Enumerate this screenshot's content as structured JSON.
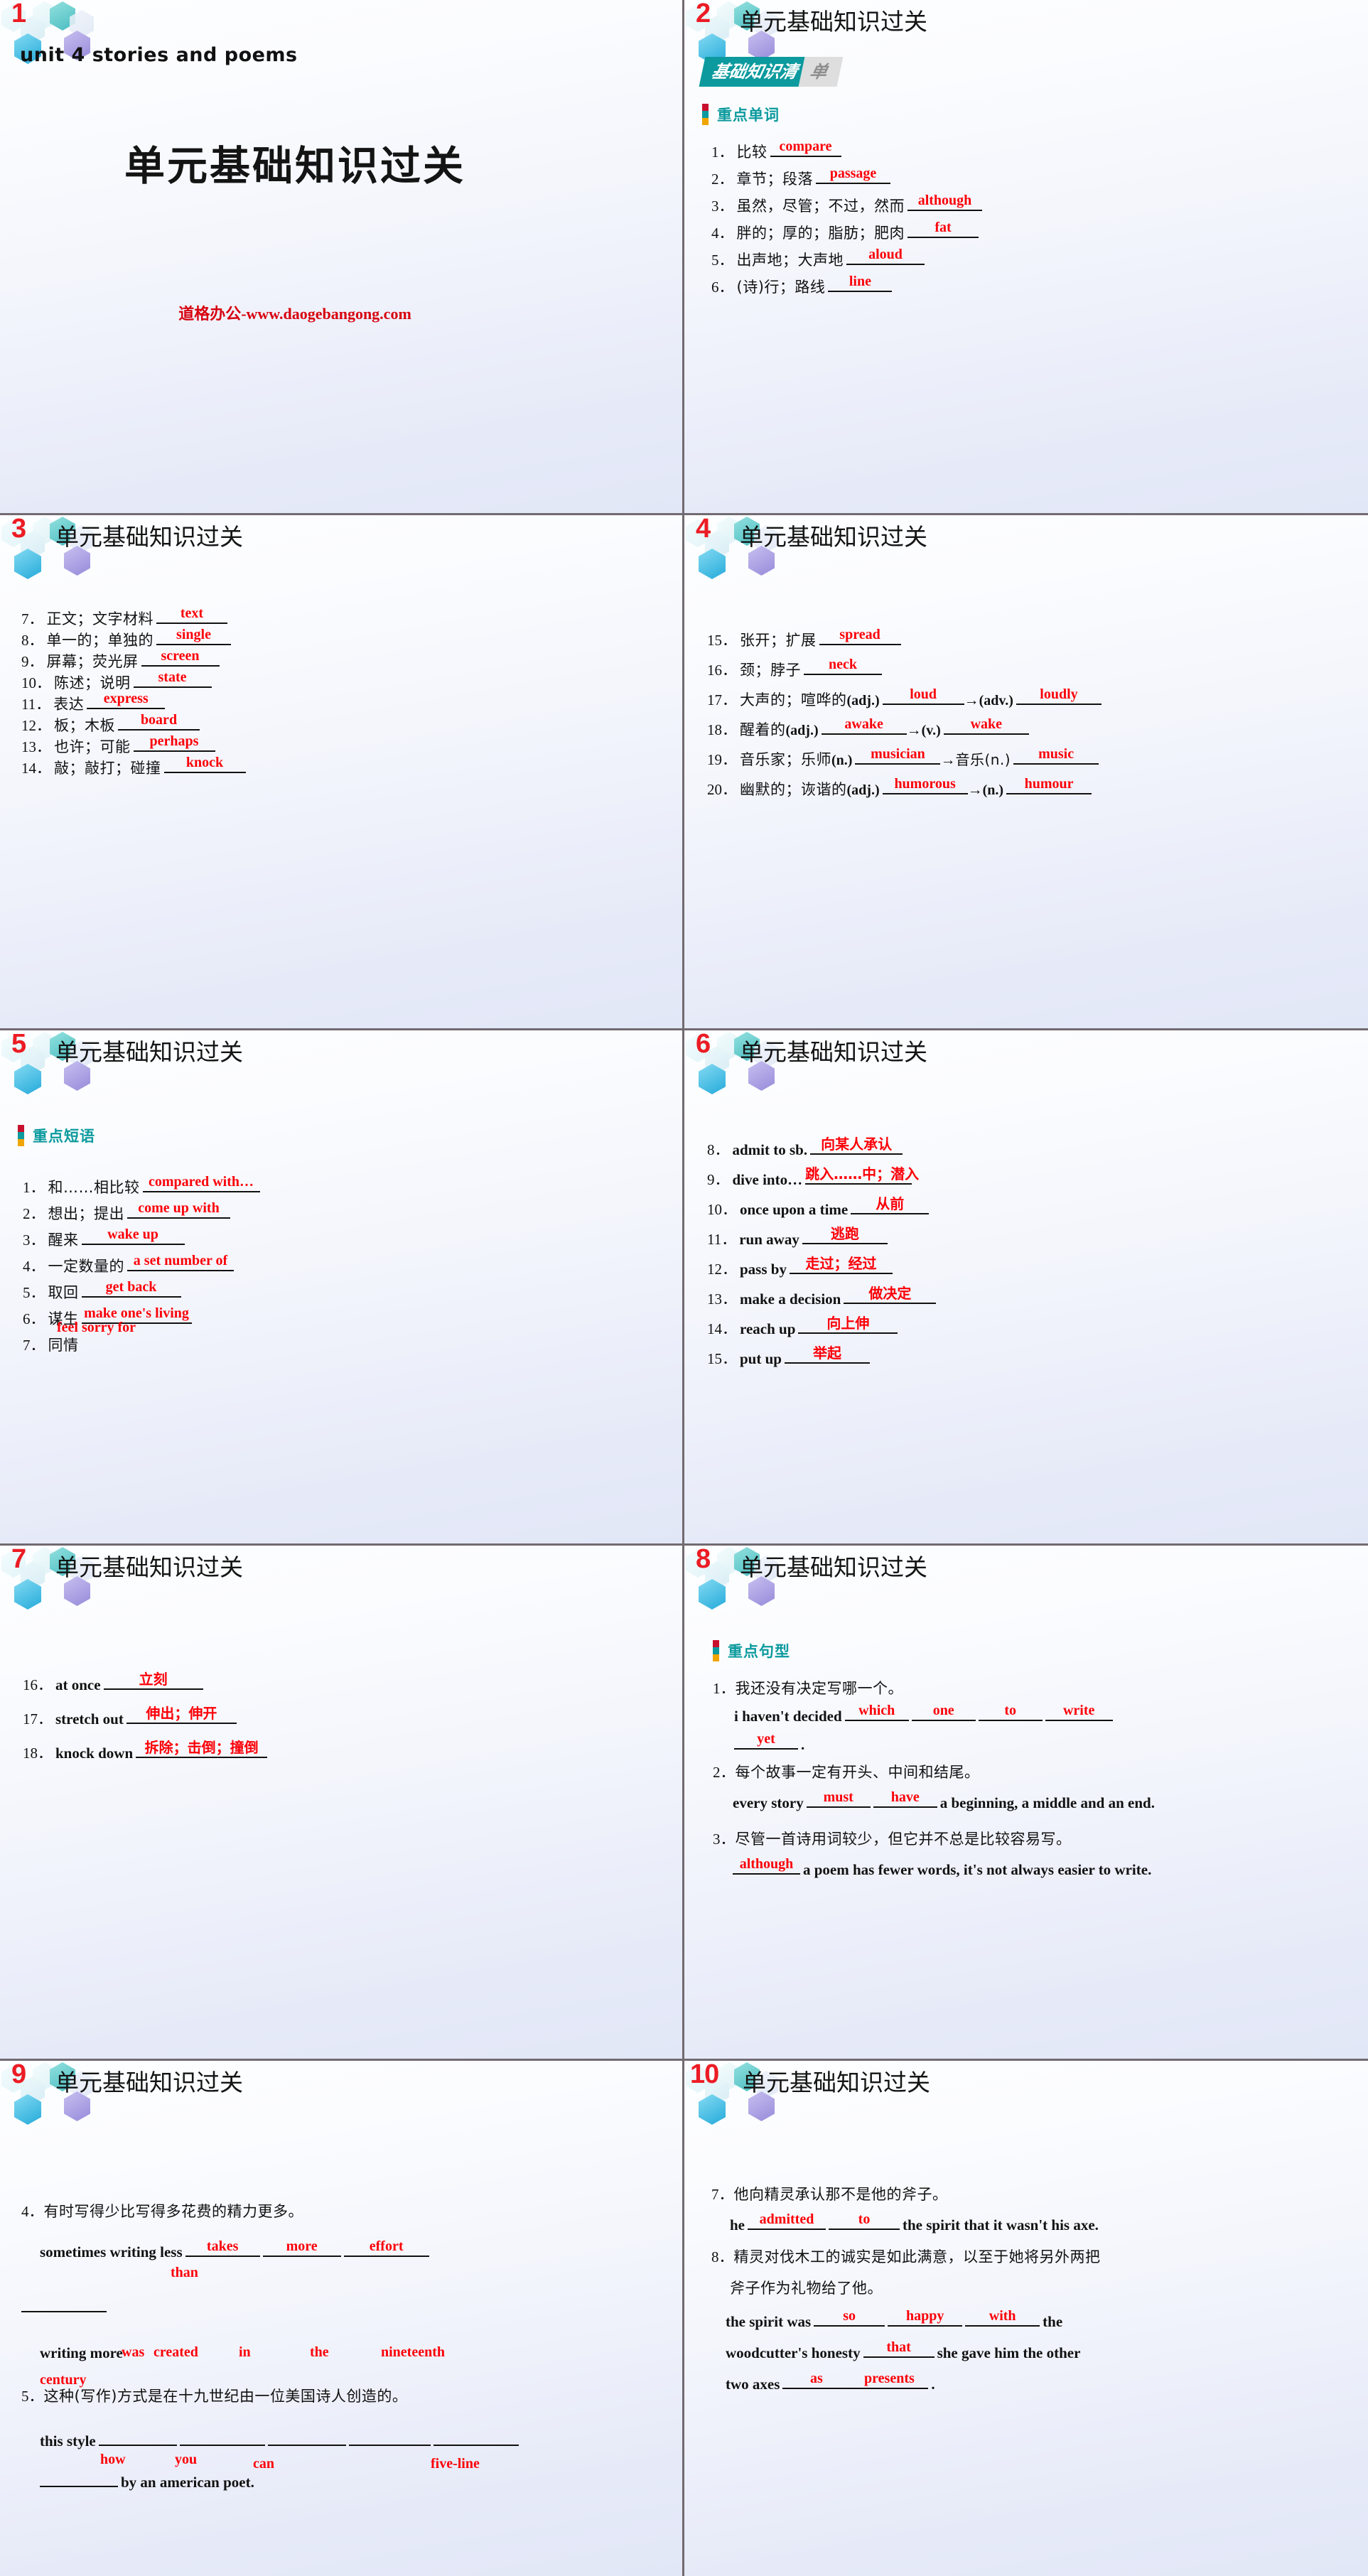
{
  "deck": {
    "header_title": "单元基础知识过关",
    "accent_red": "#fb0007",
    "accent_teal": "#0c9a9e",
    "slide_numbers": [
      "1",
      "2",
      "3",
      "4",
      "5",
      "6",
      "7",
      "8",
      "9",
      "10"
    ]
  },
  "slide1": {
    "unit_line": "unit 4  stories and poems",
    "main_title": "单元基础知识过关",
    "watermark": "道格办公-www.daogebangong.com"
  },
  "slide2": {
    "banner_left": "基础知识清",
    "banner_right": "单",
    "section_label": "重点单词",
    "items": [
      {
        "num": "1．",
        "cn": "比较",
        "answer": "compare",
        "w": 100
      },
      {
        "num": "2．",
        "cn": "章节；段落",
        "answer": "passage",
        "w": 105
      },
      {
        "num": "3．",
        "cn": "虽然，尽管；不过，然而",
        "answer": "although",
        "w": 105
      },
      {
        "num": "4．",
        "cn": "胖的；厚的；脂肪；肥肉",
        "answer": "fat",
        "w": 100
      },
      {
        "num": "5．",
        "cn": "出声地；大声地",
        "answer": "aloud",
        "w": 110
      },
      {
        "num": "6．",
        "cn": "(诗)行；路线",
        "answer": "line",
        "w": 90
      }
    ]
  },
  "slide3": {
    "items": [
      {
        "num": "7．",
        "cn": "正文；文字材料",
        "answer": "text",
        "w": 100
      },
      {
        "num": "8．",
        "cn": "单一的；单独的",
        "answer": "single",
        "w": 105
      },
      {
        "num": "9．",
        "cn": "屏幕；荧光屏",
        "answer": "screen",
        "w": 110
      },
      {
        "num": "10．",
        "cn": "陈述；说明",
        "answer": "state",
        "w": 110
      },
      {
        "num": "11．",
        "cn": "表达",
        "answer": "express",
        "w": 110
      },
      {
        "num": "12．",
        "cn": "板；木板",
        "answer": "board",
        "w": 115
      },
      {
        "num": "13．",
        "cn": "也许；可能",
        "answer": "perhaps",
        "w": 115
      },
      {
        "num": "14．",
        "cn": "敲；敲打；碰撞",
        "answer": "knock",
        "w": 115
      }
    ]
  },
  "slide4": {
    "items": [
      {
        "num": "15．",
        "cn": "张开；扩展",
        "a1": "spread",
        "w1": 115,
        "pos2": "",
        "a2": "",
        "w2": 0,
        "pos1": ""
      },
      {
        "num": "16．",
        "cn": "颈；脖子",
        "a1": "neck",
        "w1": 110,
        "pos2": "",
        "a2": "",
        "w2": 0,
        "pos1": ""
      },
      {
        "num": "17．",
        "cn": "大声的；喧哗的",
        "pos1": "(adj.)",
        "a1": "loud",
        "w1": 115,
        "pos2": "(adv.)",
        "a2": "loudly",
        "w2": 120
      },
      {
        "num": "18．",
        "cn": "醒着的",
        "pos1": "(adj.)",
        "a1": "awake",
        "w1": 120,
        "pos2": "(v.)",
        "a2": "wake",
        "w2": 120
      },
      {
        "num": "19．",
        "cn": "音乐家；乐师",
        "pos1": "(n.)",
        "a1": "musician",
        "w1": 120,
        "pos2": "音乐(n.)",
        "a2": "music",
        "w2": 120
      },
      {
        "num": "20．",
        "cn": "幽默的；诙谐的",
        "pos1": "(adj.)",
        "a1": "humorous",
        "w1": 120,
        "pos2": "(n.)",
        "a2": "humour",
        "w2": 120
      }
    ]
  },
  "slide5": {
    "section_label": "重点短语",
    "items": [
      {
        "num": "1．",
        "cn": "和……相比较",
        "answer": "compared with…",
        "w": 165
      },
      {
        "num": "2．",
        "cn": "想出；提出",
        "answer": "come up with",
        "w": 145
      },
      {
        "num": "3．",
        "cn": "醒来",
        "answer": "wake up",
        "w": 145
      },
      {
        "num": "4．",
        "cn": "一定数量的",
        "answer": "a set number of",
        "w": 150
      },
      {
        "num": "5．",
        "cn": "取回",
        "answer": "get back",
        "w": 140
      },
      {
        "num": "6．",
        "cn": "谋生",
        "answer": "make one's living",
        "w": 155
      },
      {
        "num": "7．",
        "cn": "同情",
        "answer": "feel sorry for",
        "w": 0
      }
    ]
  },
  "slide6": {
    "items": [
      {
        "num": "8．",
        "en": "admit to sb.",
        "answer": "向某人承认",
        "w": 130
      },
      {
        "num": "9．",
        "en": "dive into…",
        "answer": "跳入……中；潜入",
        "w": 150
      },
      {
        "num": "10．",
        "en": "once upon a time",
        "answer": "从前",
        "w": 110
      },
      {
        "num": "11．",
        "en": "run away",
        "answer": "逃跑",
        "w": 120
      },
      {
        "num": "12．",
        "en": "pass by",
        "answer": "走过；经过",
        "w": 145
      },
      {
        "num": "13．",
        "en": "make a decision",
        "answer": "做决定",
        "w": 130
      },
      {
        "num": "14．",
        "en": "reach up",
        "answer": "向上伸",
        "w": 140
      },
      {
        "num": "15．",
        "en": "put up",
        "answer": "举起",
        "w": 120
      }
    ]
  },
  "slide7": {
    "items": [
      {
        "num": "16．",
        "en": "at once",
        "answer": "立刻",
        "w": 140
      },
      {
        "num": "17．",
        "en": "stretch out",
        "answer": "伸出；伸开",
        "w": 155
      },
      {
        "num": "18．",
        "en": "knock down",
        "answer": "拆除；击倒；撞倒",
        "w": 185
      }
    ]
  },
  "slide8": {
    "section_label": "重点句型",
    "q1": {
      "num": "1．",
      "cn": "我还没有决定写哪一个。",
      "lead": "i haven't decided",
      "blanks": [
        {
          "answer": "which",
          "w": 90
        },
        {
          "answer": "one",
          "w": 90
        },
        {
          "answer": "to",
          "w": 90
        },
        {
          "answer": "write",
          "w": 95
        }
      ],
      "tail_blank": {
        "answer": "yet",
        "w": 90
      },
      "tail_text": "."
    },
    "q2": {
      "num": "2．",
      "cn": "每个故事一定有开头、中间和结尾。",
      "lead": "every story",
      "blanks": [
        {
          "answer": "must",
          "w": 90
        },
        {
          "answer": "have",
          "w": 90
        }
      ],
      "tail_text": "a beginning, a middle and an end."
    },
    "q3": {
      "num": "3．",
      "cn": "尽管一首诗用词较少，但它并不总是比较容易写。",
      "lead_blank": {
        "answer": "although",
        "w": 95
      },
      "tail_text": "a poem has fewer words, it's not always easier to write."
    }
  },
  "slide9": {
    "q4": {
      "num": "4．",
      "cn": "有时写得少比写得多花费的精力更多。",
      "lead": "sometimes writing less",
      "blanks": [
        {
          "answer": "takes",
          "w": 105
        },
        {
          "answer": "more",
          "w": 110
        },
        {
          "answer": "effort",
          "w": 120
        }
      ],
      "wrap_blank": {
        "answer": "than",
        "w": 120
      },
      "lead2": "writing more"
    },
    "q5": {
      "num": "5．",
      "cn": "这种(写作)方式是在十九世纪由一位美国诗人创造的。",
      "lead": "this style",
      "blanks": [
        {
          "answer": "was",
          "w": 110
        },
        {
          "answer": "created",
          "w": 120
        },
        {
          "answer": "in",
          "w": 110
        },
        {
          "answer": "the",
          "w": 115
        },
        {
          "answer": "nineteenth",
          "w": 120
        }
      ],
      "wrap_blank": {
        "answer": "century",
        "w": 120
      },
      "stray_blanks": [
        {
          "answer": "how",
          "w": 110
        },
        {
          "answer": "you",
          "w": 110
        },
        {
          "answer": "can",
          "w": 110
        },
        {
          "answer": "five-line",
          "w": 125
        }
      ],
      "tail": "by an american poet."
    }
  },
  "slide10": {
    "q7": {
      "num": "7．",
      "cn": "他向精灵承认那不是他的斧子。",
      "lead": "he",
      "blanks": [
        {
          "answer": "admitted",
          "w": 110
        },
        {
          "answer": "to",
          "w": 100
        }
      ],
      "tail": "the spirit that it wasn't his axe."
    },
    "q8": {
      "num": "8．",
      "cn1": "精灵对伐木工的诚实是如此满意，以至于她将另外两把",
      "cn2": "斧子作为礼物给了他。",
      "lead": "the spirit was",
      "blanks": [
        {
          "answer": "so",
          "w": 100
        },
        {
          "answer": "happy",
          "w": 105
        },
        {
          "answer": "with",
          "w": 105
        }
      ],
      "mid1": "the",
      "lead2": "woodcutter's honesty",
      "blank2": {
        "answer": "that",
        "w": 100
      },
      "mid2": "she gave him the other",
      "lead3": "two axes",
      "blank3a": {
        "answer": "as",
        "w": 95
      },
      "blank3b": {
        "answer": "presents",
        "w": 110
      },
      "tail": "."
    }
  }
}
